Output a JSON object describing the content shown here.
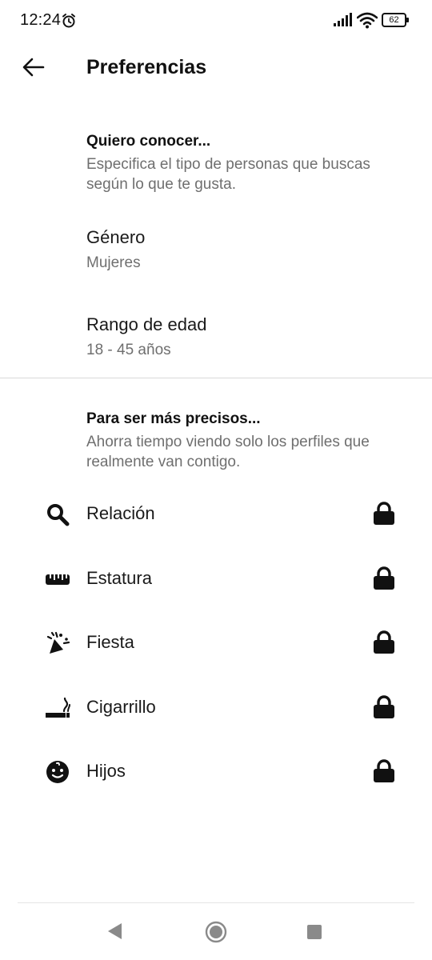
{
  "status_bar": {
    "time": "12:24",
    "battery": "62"
  },
  "header": {
    "title": "Preferencias"
  },
  "section1": {
    "title": "Quiero conocer...",
    "description": "Especifica el tipo de personas que buscas según lo que te gusta.",
    "items": [
      {
        "label": "Género",
        "value": "Mujeres"
      },
      {
        "label": "Rango de edad",
        "value": "18 - 45 años"
      }
    ]
  },
  "section2": {
    "title": "Para ser más precisos...",
    "description": "Ahorra tiempo viendo solo los perfiles que realmente van contigo.",
    "items": [
      {
        "label": "Relación",
        "icon": "search-icon"
      },
      {
        "label": "Estatura",
        "icon": "ruler-icon"
      },
      {
        "label": "Fiesta",
        "icon": "party-popper-icon"
      },
      {
        "label": "Cigarrillo",
        "icon": "smoking-icon"
      },
      {
        "label": "Hijos",
        "icon": "baby-face-icon"
      }
    ]
  },
  "colors": {
    "text_primary": "#111111",
    "text_secondary": "#6f6f6f",
    "divider": "#d9d9d9",
    "background": "#ffffff"
  }
}
